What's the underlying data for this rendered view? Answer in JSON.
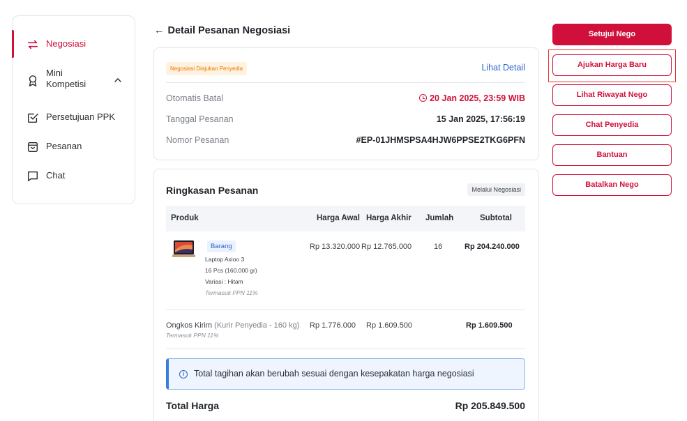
{
  "sidebar": {
    "items": [
      {
        "label": "Negosiasi",
        "icon": "swap-arrows-icon"
      },
      {
        "label": "Mini Kompetisi",
        "icon": "award-icon"
      },
      {
        "label": "Persetujuan PPK",
        "icon": "checkbox-icon"
      },
      {
        "label": "Pesanan",
        "icon": "package-icon"
      },
      {
        "label": "Chat",
        "icon": "chat-bubble-icon"
      }
    ],
    "mini_line1": "Mini",
    "mini_line2": "Kompetisi"
  },
  "header": {
    "back": "←",
    "title": "Detail Pesanan Negosiasi"
  },
  "info": {
    "badge": "Negosiasi Diajukan Penyedia",
    "link": "Lihat Detail",
    "rows": [
      {
        "label": "Otomatis Batal",
        "value": "20 Jan 2025, 23:59 WIB"
      },
      {
        "label": "Tanggal Pesanan",
        "value": "15 Jan 2025, 17:56:19"
      },
      {
        "label": "Nomor Pesanan",
        "value": "#EP-01JHMSPSA4HJW6PPSE2TKG6PFN"
      }
    ]
  },
  "summary": {
    "title": "Ringkasan Pesanan",
    "badge": "Melalui Negosiasi",
    "columns": [
      "Produk",
      "Harga Awal",
      "Harga Akhir",
      "Jumlah",
      "Subtotal"
    ],
    "product": {
      "tag": "Barang",
      "name": "Laptop Axioo 3",
      "qty_weight": "16 Pcs (160.000 gr)",
      "variant": "Variasi  : Hitam",
      "tax": "Termasuk PPN 11%",
      "harga_awal": "Rp 13.320.000",
      "harga_akhir": "Rp 12.765.000",
      "jumlah": "16",
      "subtotal": "Rp 204.240.000"
    },
    "shipping": {
      "label": "Ongkos Kirim",
      "courier": "(Kurir Penyedia - 160 kg)",
      "tax": "Termasuk PPN 11%",
      "harga_awal": "Rp 1.776.000",
      "harga_akhir": "Rp 1.609.500",
      "subtotal": "Rp 1.609.500"
    },
    "note": "Total tagihan akan berubah sesuai dengan kesepakatan harga negosiasi",
    "total_label": "Total Harga",
    "total_value": "Rp 205.849.500"
  },
  "actions": {
    "approve": "Setujui Nego",
    "new_price": "Ajukan Harga Baru",
    "history": "Lihat Riwayat Nego",
    "chat": "Chat Penyedia",
    "help": "Bantuan",
    "cancel": "Batalkan Nego"
  },
  "colors": {
    "accent": "#d0103a",
    "link": "#2a62c9",
    "warning": "#e87a00"
  }
}
